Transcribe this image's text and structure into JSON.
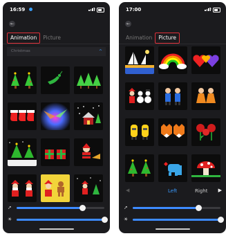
{
  "left_screen": {
    "status_time": "16:59",
    "tabs": [
      {
        "label": "Animation",
        "active": true
      },
      {
        "label": "Picture",
        "active": false
      }
    ],
    "section_title": "Christmas",
    "tiles": [
      "two-trees",
      "reindeer",
      "three-trees",
      "stockings",
      "aurora",
      "snow-house",
      "tree-snow",
      "gifts",
      "santa-sleigh",
      "two-santas",
      "santa-gingerbread",
      "santa-tree"
    ],
    "speed_level": 0.75,
    "brightness_level": 1.0
  },
  "right_screen": {
    "status_time": "17:00",
    "tabs": [
      {
        "label": "Animation",
        "active": false
      },
      {
        "label": "Picture",
        "active": true
      }
    ],
    "tiles": [
      "sailboats",
      "rainbow",
      "hearts",
      "santa-snowmen",
      "couple-blue",
      "couple-orange",
      "yellow-figures",
      "foxes",
      "roses",
      "xmas-trees",
      "elephant",
      "mushroom"
    ],
    "nav": {
      "left_label": "Left",
      "right_label": "Right",
      "selected": "Left"
    },
    "speed_level": 0.75,
    "brightness_level": 1.0
  },
  "icons": {
    "back": "back-arrow-icon",
    "collapse": "chevron-up-icon",
    "speed": "rocket-icon",
    "brightness": "sun-icon",
    "prev": "triangle-left-icon",
    "next": "triangle-right-icon"
  },
  "colors": {
    "accent": "#3d8bff",
    "tab_outline": "#e0303a",
    "screen_bg": "#1b1b1e"
  }
}
